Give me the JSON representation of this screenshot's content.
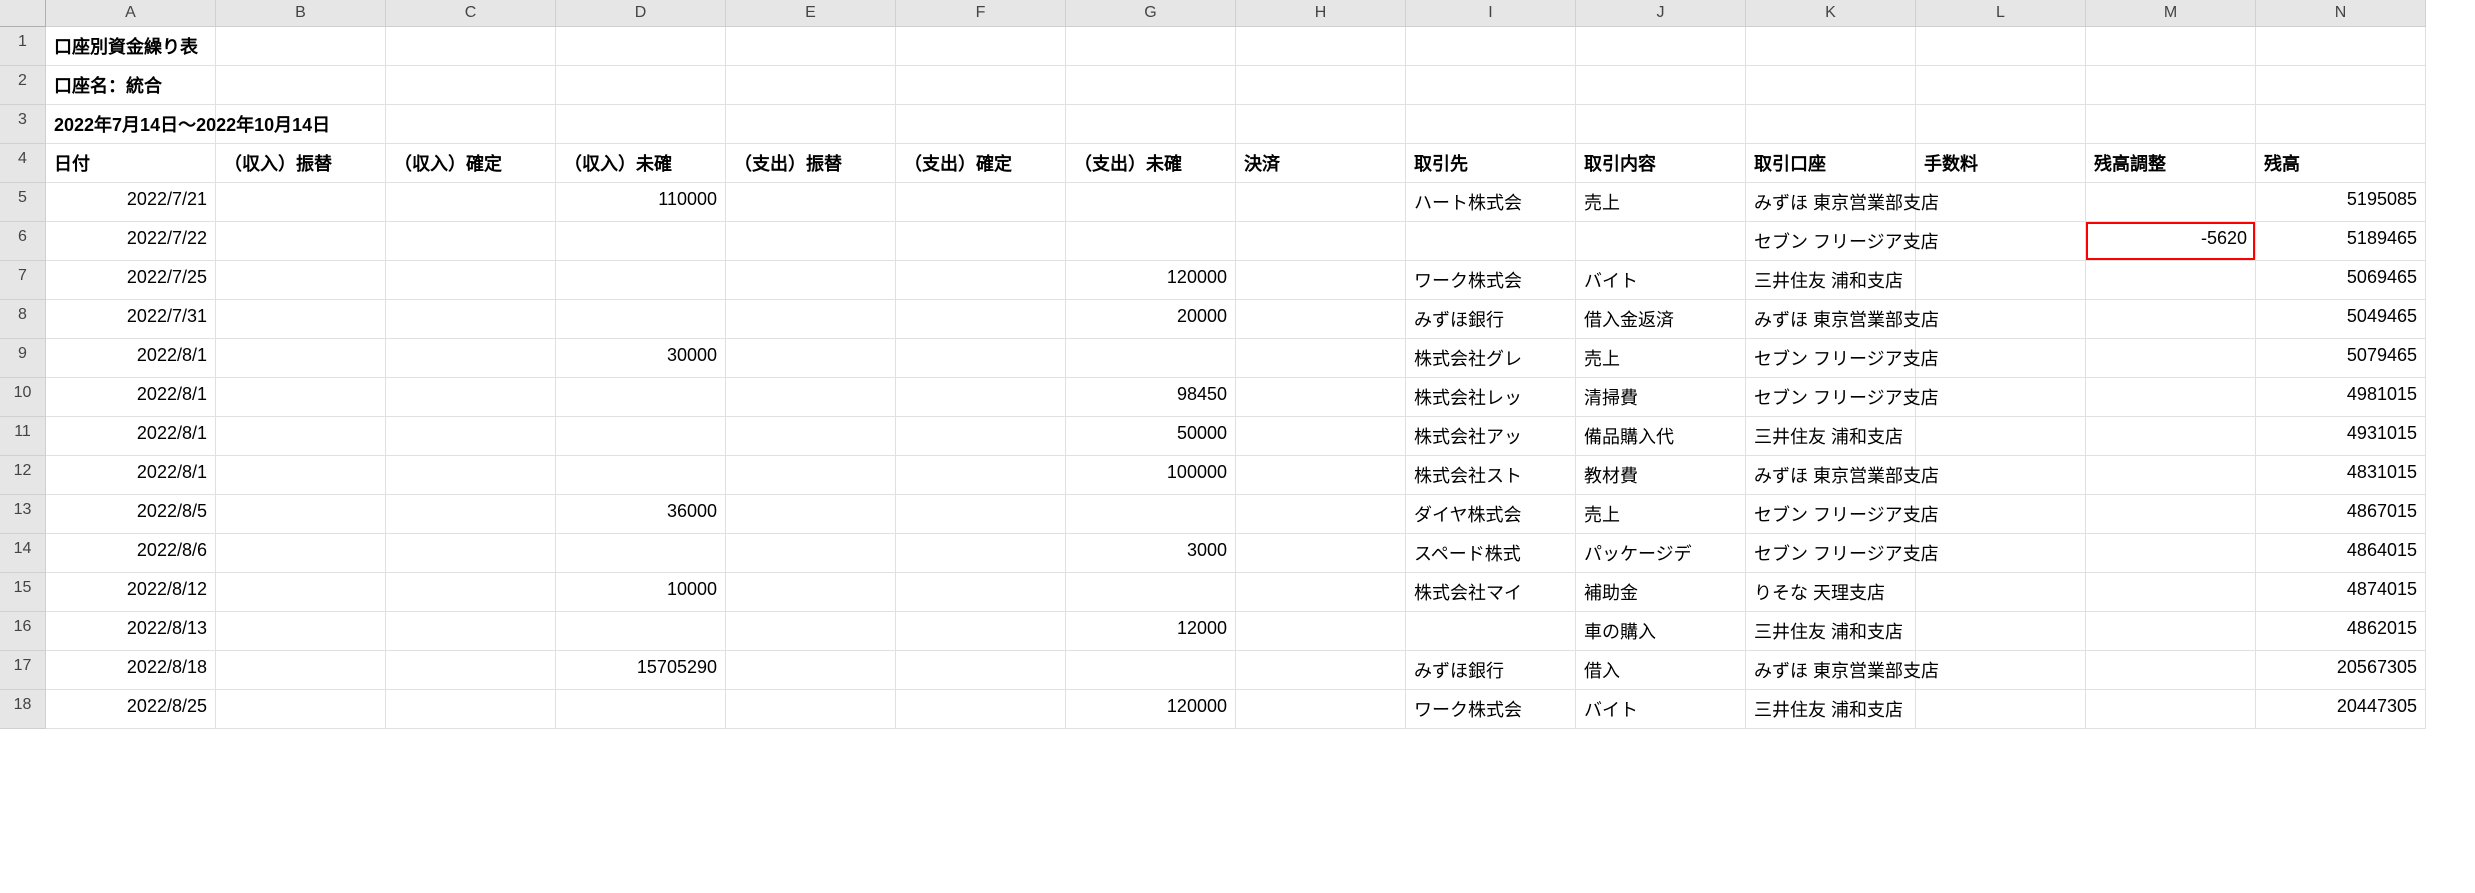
{
  "columns": [
    "A",
    "B",
    "C",
    "D",
    "E",
    "F",
    "G",
    "H",
    "I",
    "J",
    "K",
    "L",
    "M",
    "N"
  ],
  "row_numbers": [
    1,
    2,
    3,
    4,
    5,
    6,
    7,
    8,
    9,
    10,
    11,
    12,
    13,
    14,
    15,
    16,
    17,
    18
  ],
  "title_row": {
    "text": "口座別資金繰り表"
  },
  "account_row": {
    "text": "口座名：統合"
  },
  "period_row": {
    "text": "2022年7月14日～2022年10月14日"
  },
  "headers": {
    "A": "日付",
    "B": "（収入）振替",
    "C": "（収入）確定",
    "D": "（収入）未確",
    "E": "（支出）振替",
    "F": "（支出）確定",
    "G": "（支出）未確",
    "H": "決済",
    "I": "取引先",
    "J": "取引内容",
    "K": "取引口座",
    "L": "手数料",
    "M": "残高調整",
    "N": "残高"
  },
  "chart_data": {
    "type": "table",
    "columns": [
      "日付",
      "（収入）振替",
      "（収入）確定",
      "（収入）未確",
      "（支出）振替",
      "（支出）確定",
      "（支出）未確",
      "決済",
      "取引先",
      "取引内容",
      "取引口座",
      "手数料",
      "残高調整",
      "残高"
    ],
    "rows": [
      {
        "A": "2022/7/21",
        "D": "110000",
        "I": "ハート株式会",
        "J": "売上",
        "K": "みずほ 東京営業部支店",
        "N": "5195085"
      },
      {
        "A": "2022/7/22",
        "K": "セブン フリージア支店",
        "M": "-5620",
        "N": "5189465",
        "highlight_M": true
      },
      {
        "A": "2022/7/25",
        "G": "120000",
        "I": "ワーク株式会",
        "J": "バイト",
        "K": "三井住友 浦和支店",
        "N": "5069465"
      },
      {
        "A": "2022/7/31",
        "G": "20000",
        "I": "みずほ銀行",
        "J": "借入金返済",
        "K": "みずほ 東京営業部支店",
        "N": "5049465"
      },
      {
        "A": "2022/8/1",
        "D": "30000",
        "I": "株式会社グレ",
        "J": "売上",
        "K": "セブン フリージア支店",
        "N": "5079465"
      },
      {
        "A": "2022/8/1",
        "G": "98450",
        "I": "株式会社レッ",
        "J": "清掃費",
        "K": "セブン フリージア支店",
        "N": "4981015"
      },
      {
        "A": "2022/8/1",
        "G": "50000",
        "I": "株式会社アッ",
        "J": "備品購入代",
        "K": "三井住友 浦和支店",
        "N": "4931015"
      },
      {
        "A": "2022/8/1",
        "G": "100000",
        "I": "株式会社スト",
        "J": "教材費",
        "K": "みずほ 東京営業部支店",
        "N": "4831015"
      },
      {
        "A": "2022/8/5",
        "D": "36000",
        "I": "ダイヤ株式会",
        "J": "売上",
        "K": "セブン フリージア支店",
        "N": "4867015"
      },
      {
        "A": "2022/8/6",
        "G": "3000",
        "I": "スペード株式",
        "J": "パッケージデ",
        "K": "セブン フリージア支店",
        "N": "4864015"
      },
      {
        "A": "2022/8/12",
        "D": "10000",
        "I": "株式会社マイ",
        "J": "補助金",
        "K": "りそな 天理支店",
        "N": "4874015"
      },
      {
        "A": "2022/8/13",
        "G": "12000",
        "J": "車の購入",
        "K": "三井住友 浦和支店",
        "N": "4862015"
      },
      {
        "A": "2022/8/18",
        "D": "15705290",
        "I": "みずほ銀行",
        "J": "借入",
        "K": "みずほ 東京営業部支店",
        "N": "20567305"
      },
      {
        "A": "2022/8/25",
        "G": "120000",
        "I": "ワーク株式会",
        "J": "バイト",
        "K": "三井住友 浦和支店",
        "N": "20447305"
      }
    ]
  }
}
